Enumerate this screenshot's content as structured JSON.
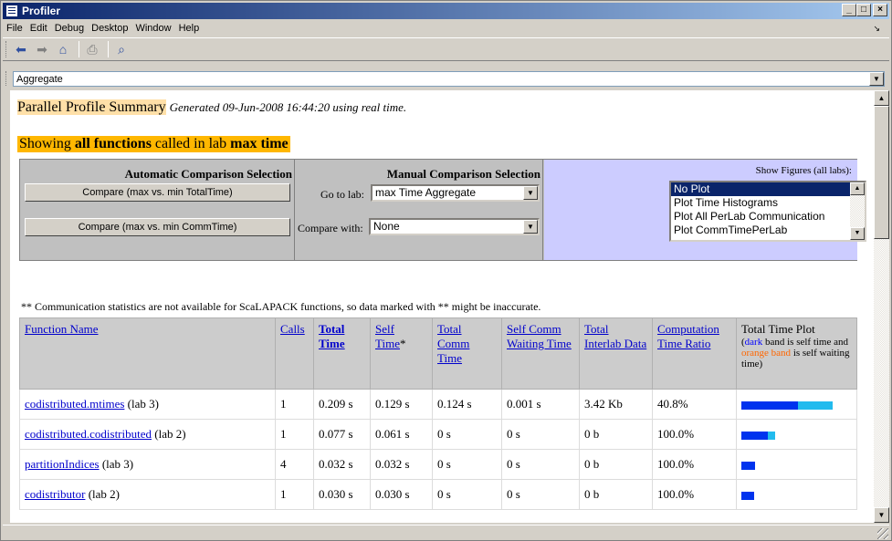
{
  "window": {
    "title": "Profiler"
  },
  "menu": [
    "File",
    "Edit",
    "Debug",
    "Desktop",
    "Window",
    "Help"
  ],
  "address": {
    "value": "Aggregate"
  },
  "summary": {
    "title": "Parallel Profile Summary",
    "generated": "Generated 09-Jun-2008 16:44:20 using real time."
  },
  "showing": {
    "prefix": "Showing ",
    "bold1": "all functions",
    "mid": " called in lab ",
    "bold2": "max time"
  },
  "automatic": {
    "header": "Automatic Comparison Selection",
    "btn_total": "Compare (max vs. min TotalTime)",
    "btn_comm": "Compare (max vs. min CommTime)"
  },
  "manual": {
    "header": "Manual Comparison Selection",
    "goto_label": "Go to lab:",
    "goto_value": "max Time Aggregate",
    "compare_label": "Compare with:",
    "compare_value": "None"
  },
  "figures": {
    "label": "Show Figures (all labs):",
    "options": [
      "No Plot",
      "Plot Time Histograms",
      "Plot All PerLab Communication",
      "Plot CommTimePerLab"
    ],
    "selected": "No Plot"
  },
  "note": "** Communication statistics are not available for ScaLAPACK functions, so data marked with ** might be inaccurate.",
  "table": {
    "headers": {
      "function": "Function Name",
      "calls": "Calls",
      "total": "Total Time",
      "self": "Self Time",
      "self_star": "*",
      "comm": "Total Comm Time",
      "wait": "Self Comm Waiting Time",
      "interlab": "Total Interlab Data",
      "ratio": "Computation Time Ratio",
      "plot": "Total Time Plot",
      "legend_open": "(",
      "legend_dark": "dark",
      "legend_mid": " band is self time and ",
      "legend_orange": "orange band",
      "legend_end": " is self waiting time)"
    },
    "rows": [
      {
        "name": "codistributed.mtimes",
        "lab": " (lab 3)",
        "calls": "1",
        "total": "0.209 s",
        "self": "0.129 s",
        "comm": "0.124 s",
        "wait": "0.001 s",
        "data": "3.42 Kb",
        "ratio": "40.8%",
        "self_frac": 0.617,
        "comm_frac": 0.383
      },
      {
        "name": "codistributed.codistributed",
        "lab": " (lab 2)",
        "calls": "1",
        "total": "0.077 s",
        "self": "0.061 s",
        "comm": "0 s",
        "wait": "0 s",
        "data": "0 b",
        "ratio": "100.0%",
        "self_frac": 0.29,
        "comm_frac": 0.08
      },
      {
        "name": "partitionIndices",
        "lab": " (lab 3)",
        "calls": "4",
        "total": "0.032 s",
        "self": "0.032 s",
        "comm": "0 s",
        "wait": "0 s",
        "data": "0 b",
        "ratio": "100.0%",
        "self_frac": 0.15,
        "comm_frac": 0
      },
      {
        "name": "codistributor",
        "lab": " (lab 2)",
        "calls": "1",
        "total": "0.030 s",
        "self": "0.030 s",
        "comm": "0 s",
        "wait": "0 s",
        "data": "0 b",
        "ratio": "100.0%",
        "self_frac": 0.14,
        "comm_frac": 0
      }
    ]
  }
}
